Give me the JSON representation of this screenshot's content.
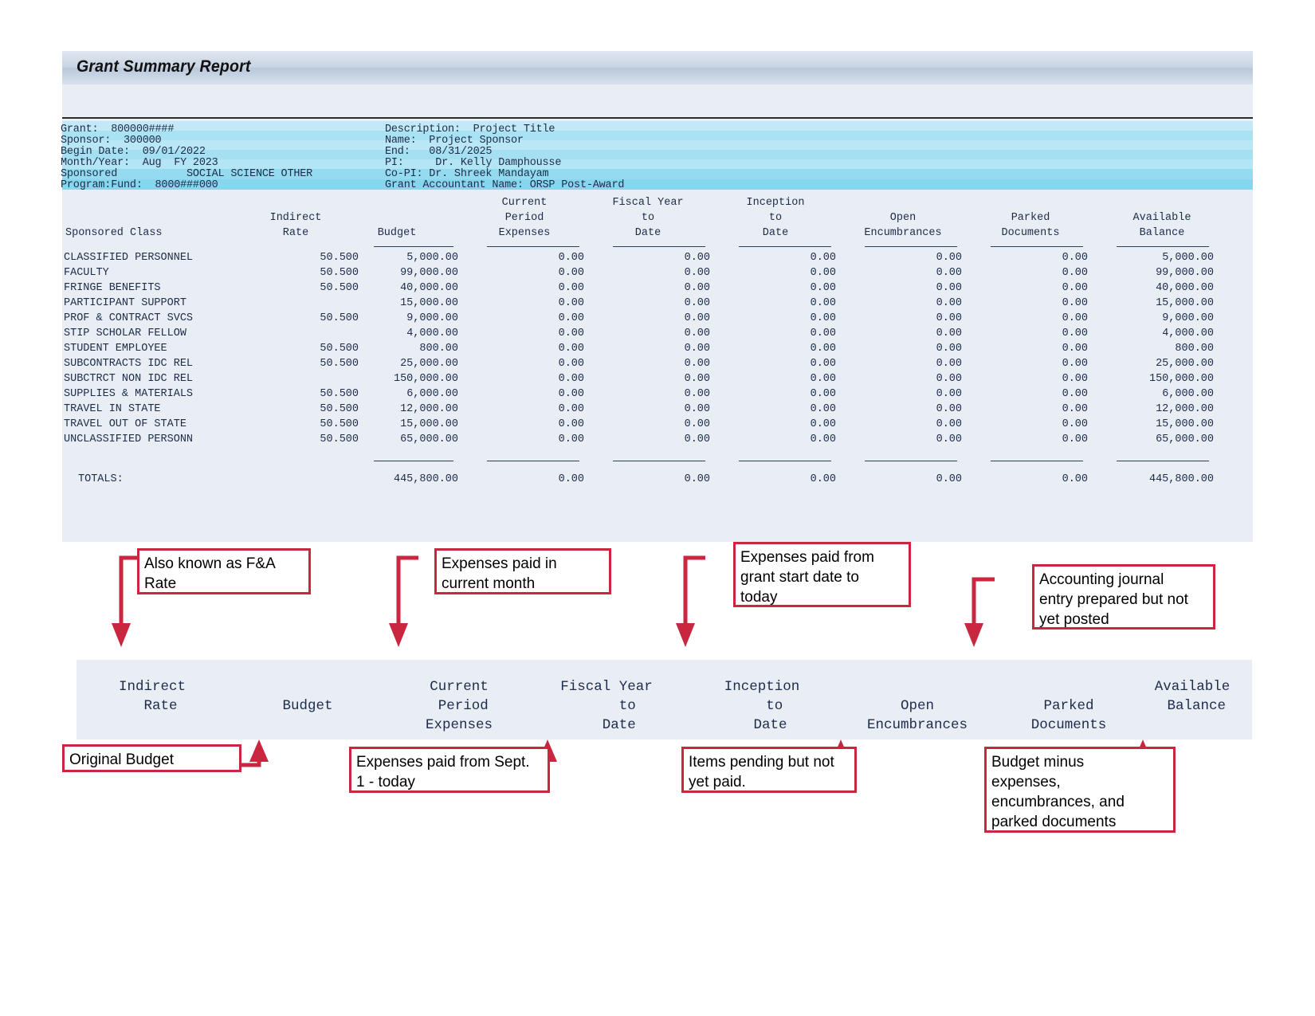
{
  "report": {
    "title": "Grant Summary Report",
    "info_left": [
      "Grant:  800000####",
      "Sponsor:  300000",
      "Begin Date:  09/01/2022",
      "Month/Year:  Aug  FY 2023",
      "Sponsored           SOCIAL SCIENCE OTHER",
      "Program:Fund:  8000###000"
    ],
    "info_right": [
      "Description:  Project Title",
      "Name:  Project Sponsor",
      "End:   08/31/2025",
      "PI:     Dr. Kelly Damphousse",
      "Co-PI: Dr. Shreek Mandayam",
      "Grant Accountant Name: ORSP Post-Award"
    ],
    "columns": [
      "Sponsored Class",
      "Indirect\nRate",
      "Budget",
      "Current\nPeriod\nExpenses",
      "Fiscal Year\nto\nDate",
      "Inception\nto\nDate",
      "Open\nEncumbrances",
      "Parked\nDocuments",
      "Available\nBalance"
    ],
    "rows": [
      {
        "class": "CLASSIFIED PERSONNEL",
        "rate": "50.500",
        "budget": "5,000.00",
        "current": "0.00",
        "fytd": "0.00",
        "itd": "0.00",
        "open": "0.00",
        "parked": "0.00",
        "available": "5,000.00"
      },
      {
        "class": "FACULTY",
        "rate": "50.500",
        "budget": "99,000.00",
        "current": "0.00",
        "fytd": "0.00",
        "itd": "0.00",
        "open": "0.00",
        "parked": "0.00",
        "available": "99,000.00"
      },
      {
        "class": "FRINGE BENEFITS",
        "rate": "50.500",
        "budget": "40,000.00",
        "current": "0.00",
        "fytd": "0.00",
        "itd": "0.00",
        "open": "0.00",
        "parked": "0.00",
        "available": "40,000.00"
      },
      {
        "class": "PARTICIPANT SUPPORT",
        "rate": "",
        "budget": "15,000.00",
        "current": "0.00",
        "fytd": "0.00",
        "itd": "0.00",
        "open": "0.00",
        "parked": "0.00",
        "available": "15,000.00"
      },
      {
        "class": "PROF & CONTRACT SVCS",
        "rate": "50.500",
        "budget": "9,000.00",
        "current": "0.00",
        "fytd": "0.00",
        "itd": "0.00",
        "open": "0.00",
        "parked": "0.00",
        "available": "9,000.00"
      },
      {
        "class": "STIP SCHOLAR FELLOW",
        "rate": "",
        "budget": "4,000.00",
        "current": "0.00",
        "fytd": "0.00",
        "itd": "0.00",
        "open": "0.00",
        "parked": "0.00",
        "available": "4,000.00"
      },
      {
        "class": "STUDENT EMPLOYEE",
        "rate": "50.500",
        "budget": "800.00",
        "current": "0.00",
        "fytd": "0.00",
        "itd": "0.00",
        "open": "0.00",
        "parked": "0.00",
        "available": "800.00"
      },
      {
        "class": "SUBCONTRACTS IDC REL",
        "rate": "50.500",
        "budget": "25,000.00",
        "current": "0.00",
        "fytd": "0.00",
        "itd": "0.00",
        "open": "0.00",
        "parked": "0.00",
        "available": "25,000.00"
      },
      {
        "class": "SUBCTRCT NON IDC REL",
        "rate": "",
        "budget": "150,000.00",
        "current": "0.00",
        "fytd": "0.00",
        "itd": "0.00",
        "open": "0.00",
        "parked": "0.00",
        "available": "150,000.00"
      },
      {
        "class": "SUPPLIES & MATERIALS",
        "rate": "50.500",
        "budget": "6,000.00",
        "current": "0.00",
        "fytd": "0.00",
        "itd": "0.00",
        "open": "0.00",
        "parked": "0.00",
        "available": "6,000.00"
      },
      {
        "class": "TRAVEL IN STATE",
        "rate": "50.500",
        "budget": "12,000.00",
        "current": "0.00",
        "fytd": "0.00",
        "itd": "0.00",
        "open": "0.00",
        "parked": "0.00",
        "available": "12,000.00"
      },
      {
        "class": "TRAVEL OUT OF STATE",
        "rate": "50.500",
        "budget": "15,000.00",
        "current": "0.00",
        "fytd": "0.00",
        "itd": "0.00",
        "open": "0.00",
        "parked": "0.00",
        "available": "15,000.00"
      },
      {
        "class": "UNCLASSIFIED PERSONN",
        "rate": "50.500",
        "budget": "65,000.00",
        "current": "0.00",
        "fytd": "0.00",
        "itd": "0.00",
        "open": "0.00",
        "parked": "0.00",
        "available": "65,000.00"
      }
    ],
    "totals": {
      "label": "TOTALS:",
      "rate": "",
      "budget": "445,800.00",
      "current": "0.00",
      "fytd": "0.00",
      "itd": "0.00",
      "open": "0.00",
      "parked": "0.00",
      "available": "445,800.00"
    }
  },
  "band": {
    "indirect_rate": "Indirect\n  Rate",
    "budget": "Budget",
    "current_period_expenses": "Current\n Period\nExpenses",
    "fiscal_year_to_date": "Fiscal Year\n     to\n   Date",
    "inception_to_date": "Inception\n   to\n  Date",
    "open_encumbrances": "Open\nEncumbrances",
    "parked_documents": "Parked\nDocuments",
    "available_balance": "Available\n Balance"
  },
  "callouts": {
    "fa_rate": "Also known as F&A\nRate",
    "current_month": "Expenses paid in\ncurrent month",
    "inception": "Expenses paid from\ngrant start date to\ntoday",
    "parked": "Accounting journal\nentry prepared but not\nyet posted",
    "original_budget": "Original Budget",
    "fiscal_year": "Expenses paid from Sept.\n1 - today",
    "open_enc": "Items pending but not\nyet paid.",
    "available": "Budget minus\nexpenses,\nencumbrances, and\nparked documents"
  },
  "colors": {
    "annotation": "#c9263f",
    "panel": "#e9eef5",
    "info_band": "#a9e2f3",
    "mono_text": "#1d2c4a"
  }
}
